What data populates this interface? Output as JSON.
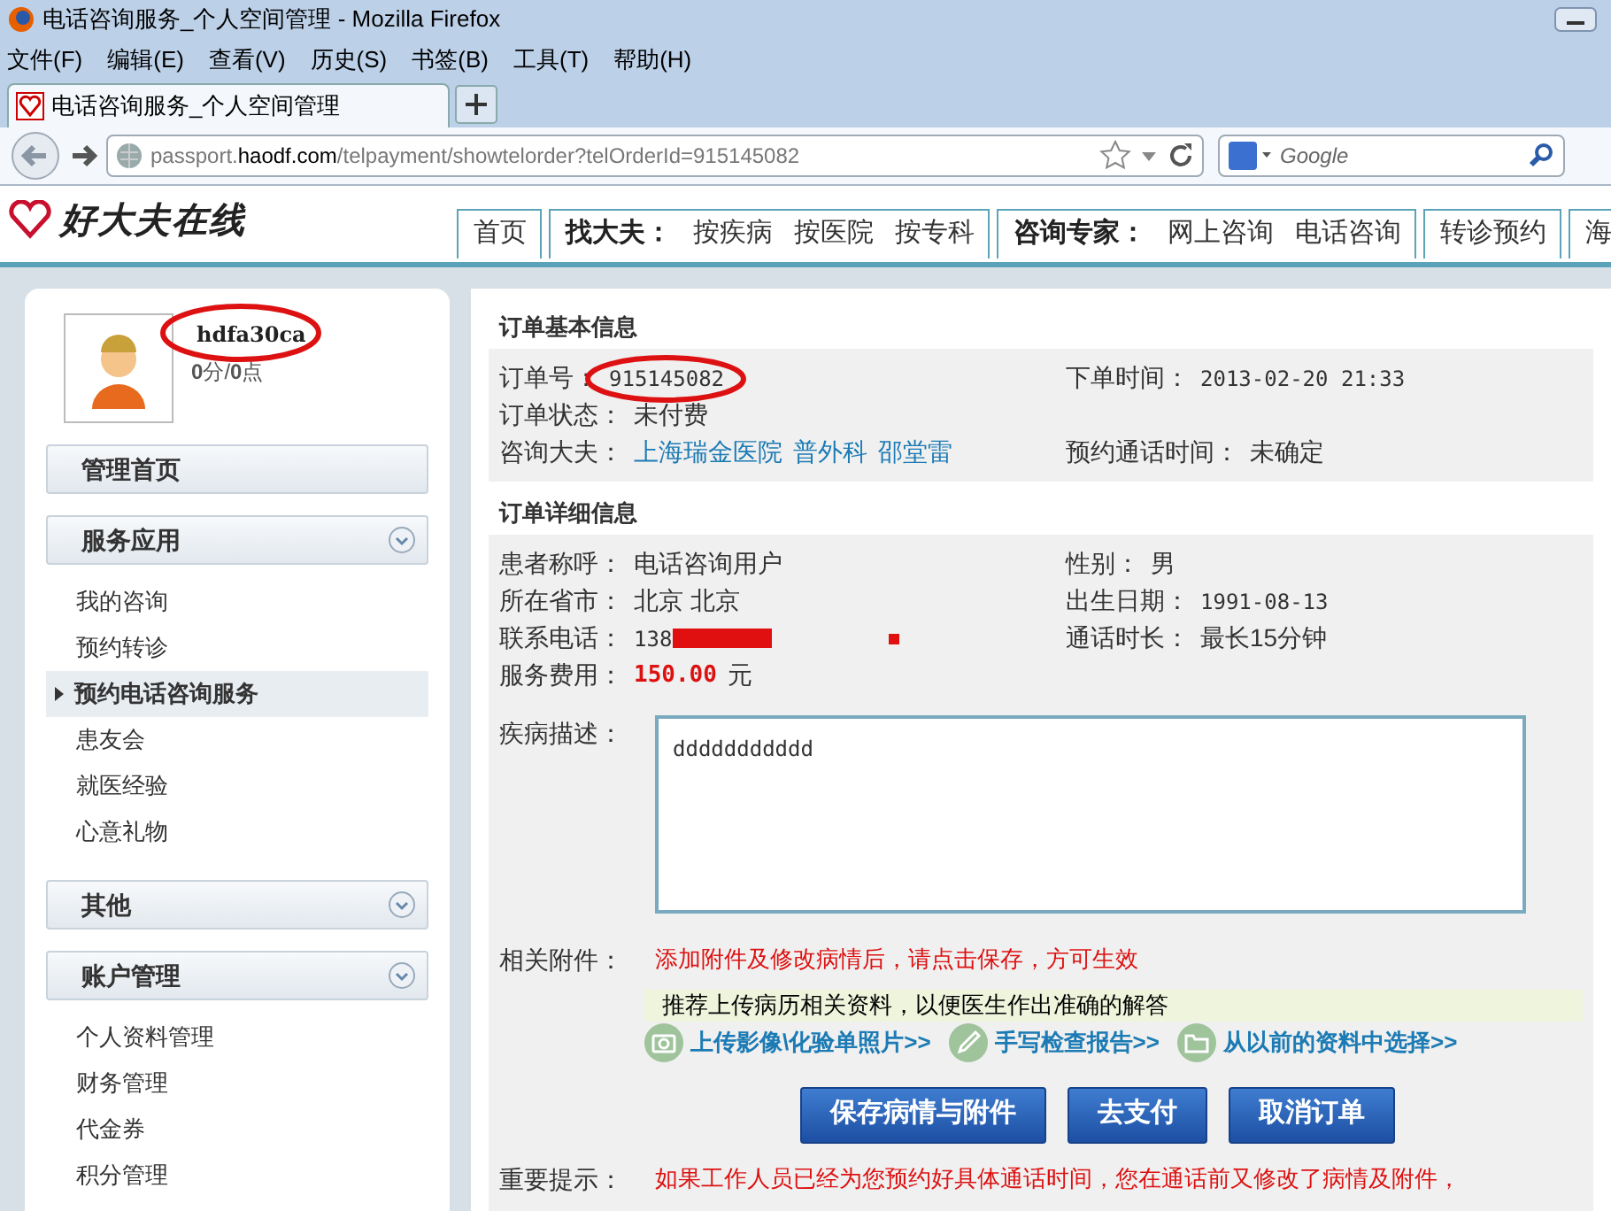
{
  "window": {
    "title": "电话咨询服务_个人空间管理 - Mozilla Firefox"
  },
  "menu_bar": [
    "文件(F)",
    "编辑(E)",
    "查看(V)",
    "历史(S)",
    "书签(B)",
    "工具(T)",
    "帮助(H)"
  ],
  "tabs": [
    {
      "label": "电话咨询服务_个人空间管理",
      "selected": true
    }
  ],
  "address_bar": {
    "host_prefix": "passport.",
    "host": "haodf.com",
    "path": "/telpayment/showtelorder?telOrderId=915145082"
  },
  "search": {
    "placeholder": "Google"
  },
  "site": {
    "logo": "好大夫在线",
    "nav": [
      [
        {
          "label": "首页",
          "kind": "link"
        }
      ],
      [
        {
          "label": "找大夫：",
          "kind": "heading"
        },
        {
          "label": "按疾病",
          "kind": "link"
        },
        {
          "label": "按医院",
          "kind": "link"
        },
        {
          "label": "按专科",
          "kind": "link"
        }
      ],
      [
        {
          "label": "咨询专家：",
          "kind": "heading"
        },
        {
          "label": "网上咨询",
          "kind": "link"
        },
        {
          "label": "电话咨询",
          "kind": "link"
        }
      ],
      [
        {
          "label": "转诊预约",
          "kind": "link"
        }
      ],
      [
        {
          "label": "海",
          "kind": "link"
        }
      ]
    ]
  },
  "user": {
    "name": "hdfa30ca",
    "points": "**0**分/**0**点"
  },
  "sidebar": [
    {
      "title": "管理首页",
      "collapsible": false
    },
    {
      "title": "服务应用",
      "collapsible": true,
      "items": [
        {
          "label": "我的咨询",
          "selected": false
        },
        {
          "label": "预约转诊",
          "selected": false
        },
        {
          "label": "预约电话咨询服务",
          "selected": true
        },
        {
          "label": "患友会",
          "selected": false
        },
        {
          "label": "就医经验",
          "selected": false
        },
        {
          "label": "心意礼物",
          "selected": false
        }
      ]
    },
    {
      "title": "其他",
      "collapsible": true
    },
    {
      "title": "账户管理",
      "collapsible": true,
      "items": [
        {
          "label": "个人资料管理",
          "selected": false
        },
        {
          "label": "财务管理",
          "selected": false
        },
        {
          "label": "代金券",
          "selected": false
        },
        {
          "label": "积分管理",
          "selected": false
        }
      ]
    }
  ],
  "basic_info": {
    "title": "订单基本信息",
    "rows": [
      [
        {
          "label": "订单号：",
          "value": [
            "915145082"
          ],
          "kind": "mono",
          "circled": true
        },
        {
          "label": "下单时间：",
          "value": [
            "2013-02-20 21:33"
          ],
          "kind": "mono"
        }
      ],
      [
        {
          "label": "订单状态：",
          "value": [
            "未付费"
          ],
          "kind": "text"
        }
      ],
      [
        {
          "label": "咨询大夫：",
          "value": [
            "上海瑞金医院",
            "普外科",
            "邵堂雷"
          ],
          "kind": "links"
        },
        {
          "label": "预约通话时间：",
          "value": [
            "未确定"
          ],
          "kind": "text"
        }
      ]
    ]
  },
  "detail_info": {
    "title": "订单详细信息",
    "rows": [
      [
        {
          "label": "患者称呼：",
          "value": [
            "电话咨询用户"
          ],
          "kind": "text"
        },
        {
          "label": "性别：",
          "value": [
            "男"
          ],
          "kind": "text"
        }
      ],
      [
        {
          "label": "所在省市：",
          "value": [
            "北京 北京"
          ],
          "kind": "text"
        },
        {
          "label": "出生日期：",
          "value": [
            "1991-08-13"
          ],
          "kind": "mono"
        }
      ],
      [
        {
          "label": "联系电话：",
          "value": [
            "138"
          ],
          "kind": "redacted"
        },
        {
          "label": "通话时长：",
          "value": [
            "最长15分钟"
          ],
          "kind": "text"
        }
      ],
      [
        {
          "label": "服务费用：",
          "value": [
            "150.00",
            "元"
          ],
          "kind": "price"
        }
      ]
    ]
  },
  "description": {
    "label": "疾病描述：",
    "value": "ddddddddddd"
  },
  "attachments": {
    "label": "相关附件：",
    "notice": "添加附件及修改病情后，请点击保存，方可生效",
    "tip": "推荐上传病历相关资料，以便医生作出准确的解答",
    "actions": [
      {
        "label": "上传影像\\化验单照片>>",
        "kind": "camera"
      },
      {
        "label": "手写检查报告>>",
        "kind": "pencil"
      },
      {
        "label": "从以前的资料中选择>>",
        "kind": "folder"
      }
    ]
  },
  "buttons": [
    "保存病情与附件",
    "去支付",
    "取消订单"
  ],
  "important": {
    "label": "重要提示：",
    "text": "如果工作人员已经为您预约好具体通话时间，您在通话前又修改了病情及附件，"
  }
}
